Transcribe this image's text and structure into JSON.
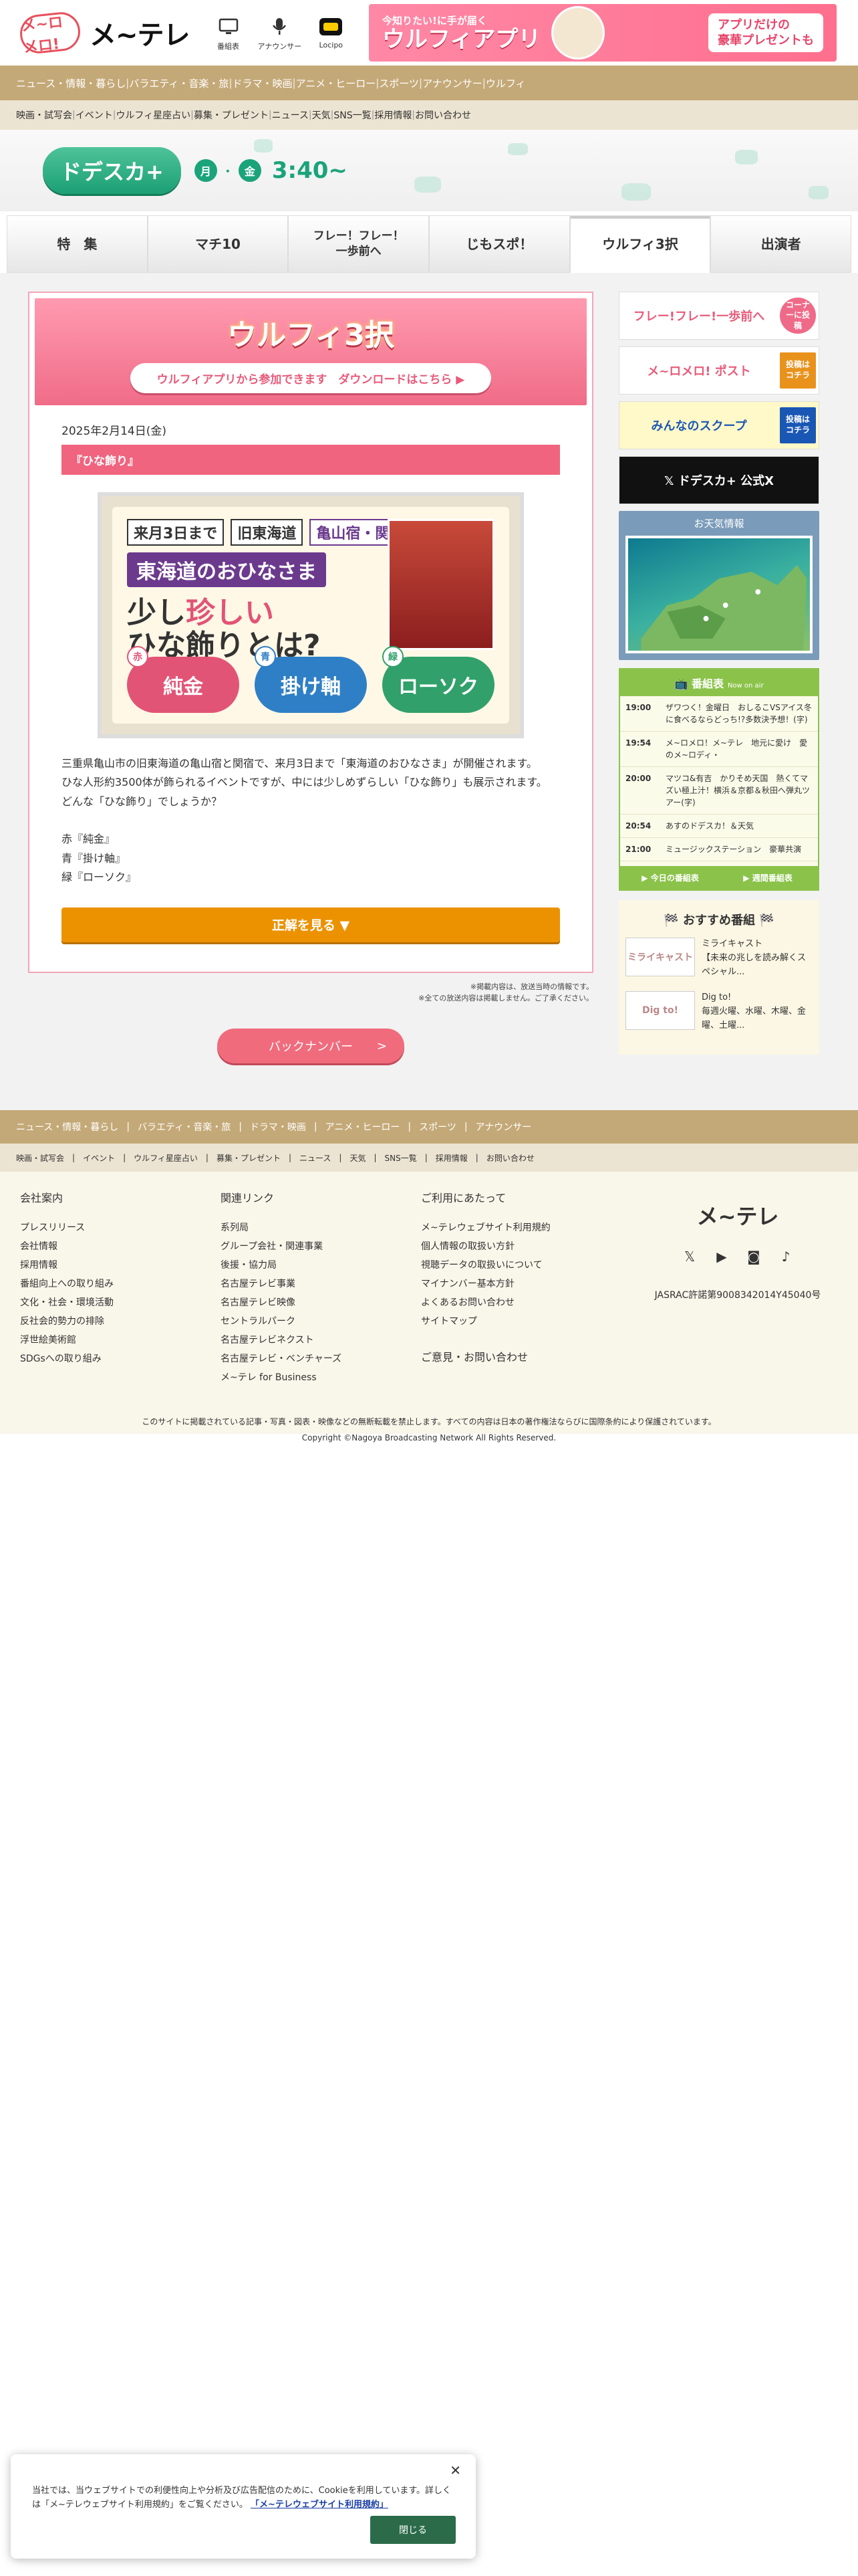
{
  "header": {
    "logo_badge": "メ~ロメロ!",
    "logo_text": "メ~テレ",
    "icons": [
      {
        "name": "tv-guide-icon",
        "label": "番組表"
      },
      {
        "name": "microphone-icon",
        "label": "アナウンサー"
      },
      {
        "name": "locipo-icon",
        "label": "Locipo"
      }
    ],
    "banner": {
      "small": "今知りたい!に手が届く",
      "big": "ウルフィアプリ",
      "right": "アプリだけの\n豪華プレゼントも"
    }
  },
  "nav_primary": [
    "ニュース・情報・暮らし",
    "バラエティ・音楽・旅",
    "ドラマ・映画",
    "アニメ・ヒーロー",
    "スポーツ",
    "アナウンサー",
    "ウルフィ"
  ],
  "nav_secondary": [
    "映画・試写会",
    "イベント",
    "ウルフィ星座占い",
    "募集・プレゼント",
    "ニュース",
    "天気",
    "SNS一覧",
    "採用情報",
    "お問い合わせ"
  ],
  "show": {
    "logo": "ドデスカ+",
    "days": [
      "月",
      "金"
    ],
    "time": "3:40~"
  },
  "tabs": [
    "特　集",
    "マチ10",
    "フレー！フレー！\n一歩前へ",
    "じもスポ！",
    "ウルフィ3択",
    "出演者"
  ],
  "article": {
    "header_title": "ウルフィ3択",
    "header_button": "ウルフィアプリから参加できます　ダウンロードはこちら ▶",
    "date": "2025年2月14日(金)",
    "title": "『ひな飾り』",
    "photo": {
      "tag1": "来月3日まで",
      "tag2": "旧東海道",
      "tag3": "亀山宿・関宿",
      "sub": "東海道のおひなさま",
      "q1": "少し",
      "q_em": "珍しい",
      "q2": "ひな飾りとは?",
      "answers": [
        {
          "label": "赤",
          "text": "純金",
          "color": "#e25476"
        },
        {
          "label": "青",
          "text": "掛け軸",
          "color": "#2f7fc6"
        },
        {
          "label": "緑",
          "text": "ローソク",
          "color": "#31a06a"
        }
      ]
    },
    "paragraphs": [
      "三重県亀山市の旧東海道の亀山宿と関宿で、来月3日まで「東海道のおひなさま」が開催されます。",
      "ひな人形約3500体が飾られるイベントですが、中には少しめずらしい「ひな飾り」も展示されます。",
      "どんな「ひな飾り」でしょうか？",
      "",
      "赤『純金』",
      "青『掛け軸』",
      "緑『ローソク』"
    ],
    "cta": "正解を見る ▼",
    "notes": [
      "※掲載内容は、放送当時の情報です。",
      "※全ての放送内容は掲載しません。ご了承ください。"
    ]
  },
  "back_number": {
    "label": "バックナンバー",
    "arrow": ">"
  },
  "sidebar": {
    "banners": [
      {
        "name": "ippomae-banner",
        "text": "フレー!フレー!一歩前へ",
        "side": "コーナーに投稿",
        "bg": "#fff",
        "fg": "#e85b7a"
      },
      {
        "name": "meromero-post-banner",
        "text": "メ~ロメロ! ポスト",
        "side": "投稿はコチラ",
        "bg": "#fff",
        "fg": "#e85b7a"
      },
      {
        "name": "minna-scoop-banner",
        "text": "みんなのスクープ",
        "side": "投稿はコチラ",
        "bg": "#fff8c8",
        "fg": "#1a57b5"
      },
      {
        "name": "x-official-banner",
        "text": "𝕏 ドデスカ+ 公式X",
        "side": "",
        "bg": "#111",
        "fg": "#fff"
      }
    ],
    "weather_title": "お天気情報",
    "programs": {
      "title": "番組表",
      "subtitle": "Now on air",
      "items": [
        {
          "time": "19:00",
          "name": "ザワつく！金曜日　おしるこVSアイス冬に食べるならどっち!?多数決予想！(字)"
        },
        {
          "time": "19:54",
          "name": "メ~ロメロ！メ~テレ　地元に愛け　愛のメ~ロディ・"
        },
        {
          "time": "20:00",
          "name": "マツコ&有吉　かりそめ天国　熱くてマズい極上汁！横浜＆京都＆秋田へ弾丸ツアー(字)"
        },
        {
          "time": "20:54",
          "name": "あすのドデスカ！＆天気"
        },
        {
          "time": "21:00",
          "name": "ミュージックステーション　豪華共演"
        }
      ],
      "footer": [
        "▶ 今日の番組表",
        "▶ 週間番組表"
      ]
    },
    "recommend": {
      "title": "おすすめ番組",
      "items": [
        {
          "thumb": "ミライキャスト",
          "text": "ミライキャスト\n【未来の兆しを読み解くスペシャル..."
        },
        {
          "thumb": "Dig to!",
          "text": "Dig to!\n毎週火曜、水曜、木曜、金曜、土曜..."
        }
      ]
    }
  },
  "footer": {
    "nav_primary": [
      "ニュース・情報・暮らし",
      "バラエティ・音楽・旅",
      "ドラマ・映画",
      "アニメ・ヒーロー",
      "スポーツ",
      "アナウンサー"
    ],
    "nav_secondary": [
      "映画・試写会",
      "イベント",
      "ウルフィ星座占い",
      "募集・プレゼント",
      "ニュース",
      "天気",
      "SNS一覧",
      "採用情報",
      "お問い合わせ"
    ],
    "columns": [
      {
        "title": "会社案内",
        "items": [
          "プレスリリース",
          "会社情報",
          "採用情報",
          "番組向上への取り組み",
          "文化・社会・環境活動",
          "反社会的勢力の排除",
          "浮世絵美術館",
          "SDGsへの取り組み"
        ]
      },
      {
        "title": "関連リンク",
        "items": [
          "系列局",
          "グループ会社・関連事業",
          "後援・協力局",
          "名古屋テレビ事業",
          "名古屋テレビ映像",
          "セントラルパーク",
          "名古屋テレビネクスト",
          "名古屋テレビ・ベンチャーズ",
          "メ~テレ for Business"
        ]
      },
      {
        "title": "ご利用にあたって",
        "items": [
          "メ~テレウェブサイト利用規約",
          "個人情報の取扱い方針",
          "視聴データの取扱いについて",
          "マイナンバー基本方針",
          "よくあるお問い合わせ",
          "サイトマップ"
        ],
        "extra": "ご意見・お問い合わせ"
      }
    ],
    "brand": "メ~テレ",
    "jasrac": "JASRAC許諾第9008342014Y45040号",
    "notice": "このサイトに掲載されている記事・写真・図表・映像などの無断転載を禁止します。すべての内容は日本の著作権法ならびに国際条約により保護されています。",
    "copyright": "Copyright ©Nagoya Broadcasting Network All Rights Reserved."
  },
  "cookie": {
    "text_before": "当社では、当ウェブサイトでの利便性向上や分析及び広告配信のために、Cookieを利用しています。詳しくは「メ~テレウェブサイト利用規約」をご覧ください。",
    "link": "「メ~テレウェブサイト利用規約」",
    "close": "閉じる"
  }
}
